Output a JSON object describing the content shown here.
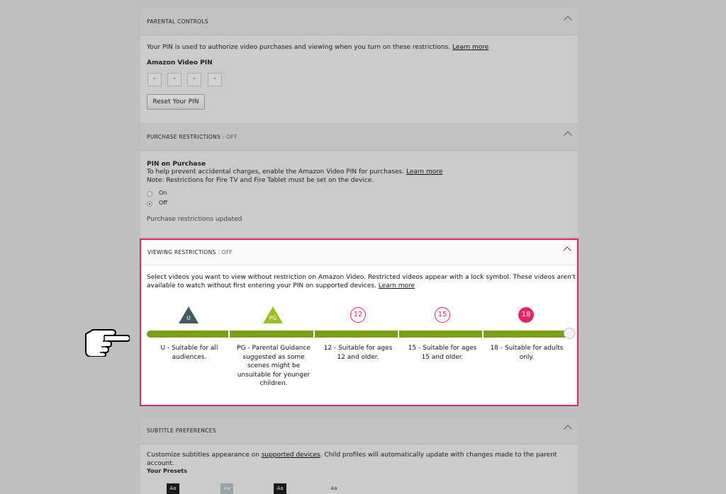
{
  "parental": {
    "title": "PARENTAL CONTROLS",
    "description": "Your PIN is used to authorize video purchases and viewing when you turn on these restrictions.",
    "learn_more": "Learn more",
    "pin_label": "Amazon Video PIN",
    "pin_digits": [
      "*",
      "*",
      "*",
      "*"
    ],
    "reset_button": "Reset Your PIN"
  },
  "purchase": {
    "title": "PURCHASE RESTRICTIONS",
    "status": " : OFF",
    "heading": "PIN on Purchase",
    "description": "To help prevent accidental charges, enable the Amazon Video PIN for purchases.",
    "learn_more": "Learn more",
    "note": "Note: Restrictions for Fire TV and Fire Tablet must be set on the device.",
    "option_on": "On",
    "option_off": "Off",
    "selected": "Off",
    "updated_msg": "Purchase restrictions updated"
  },
  "viewing": {
    "title": "VIEWING RESTRICTIONS",
    "status": " : OFF",
    "description_1": "Select videos you want to view without restriction on Amazon Video. Restricted videos appear with a lock symbol. These videos aren't",
    "description_2": "available to watch without first entering your PIN on supported devices.",
    "learn_more": "Learn more",
    "slider_level": 1.0,
    "ratings": [
      {
        "badge": "U",
        "label": "U - Suitable for all audiences."
      },
      {
        "badge": "PG",
        "label": "PG - Parental Guidance suggested as some scenes might be unsuitable for younger children."
      },
      {
        "badge": "12",
        "label": "12 - Suitable for ages 12 and older."
      },
      {
        "badge": "15",
        "label": "15 - Suitable for ages 15 and older."
      },
      {
        "badge": "18",
        "label": "18 - Suitable for adults only."
      }
    ]
  },
  "subtitle": {
    "title": "SUBTITLE PREFERENCES",
    "description_pre": "Customize subtitles appearance on",
    "supported_devices": "supported devices",
    "description_post": ". Child profiles will automatically update with changes made to the parent account.",
    "presets_label": "Your Presets",
    "presets": [
      "Aa",
      "Aa",
      "Aa",
      "Aa"
    ]
  },
  "colors": {
    "highlight": "#e8245f",
    "slider_green": "#7aa017",
    "u_badge": "#445a66",
    "pg_badge": "#9bbf1e"
  },
  "icons": [
    "chevron-up-icon",
    "pointing-hand-cursor-icon",
    "u-rating-icon",
    "pg-rating-icon",
    "rating-12-icon",
    "rating-15-icon",
    "rating-18-icon"
  ]
}
